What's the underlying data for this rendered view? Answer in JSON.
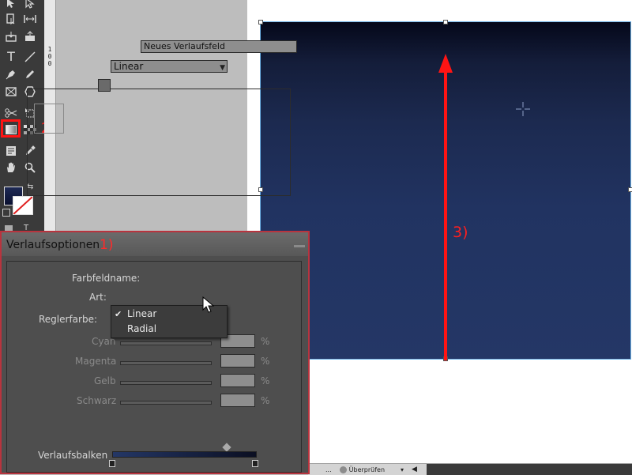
{
  "toolbar": {
    "highlight_color": "#ff1414",
    "tools": [
      {
        "id": "selection",
        "icon": "selection-arrow-icon"
      },
      {
        "id": "direct-selection",
        "icon": "direct-selection-arrow-icon"
      },
      {
        "id": "page",
        "icon": "page-tool-icon"
      },
      {
        "id": "gap",
        "icon": "gap-tool-icon"
      },
      {
        "id": "content-collector",
        "icon": "content-collector-icon"
      },
      {
        "id": "content-placer",
        "icon": "content-placer-icon"
      },
      {
        "id": "type",
        "icon": "type-tool-icon",
        "glyph": "T"
      },
      {
        "id": "line",
        "icon": "line-tool-icon"
      },
      {
        "id": "pen",
        "icon": "pen-tool-icon"
      },
      {
        "id": "pencil",
        "icon": "pencil-tool-icon"
      },
      {
        "id": "rectangle-frame",
        "icon": "rectangle-frame-icon"
      },
      {
        "id": "polygon",
        "icon": "polygon-tool-icon"
      },
      {
        "id": "scissors",
        "icon": "scissors-icon"
      },
      {
        "id": "free-transform",
        "icon": "free-transform-icon"
      },
      {
        "id": "gradient-swatch",
        "icon": "gradient-swatch-tool-icon"
      },
      {
        "id": "gradient-feather",
        "icon": "gradient-feather-tool-icon"
      },
      {
        "id": "note",
        "icon": "note-tool-icon"
      },
      {
        "id": "eyedropper",
        "icon": "eyedropper-icon"
      },
      {
        "id": "hand",
        "icon": "hand-tool-icon"
      },
      {
        "id": "zoom",
        "icon": "zoom-tool-icon"
      }
    ]
  },
  "annotations": {
    "one": "1)",
    "two": "2)",
    "three": "3)",
    "color": "#ff1f1f"
  },
  "ruler": {
    "label": "1\n0\n0"
  },
  "canvas": {
    "gradient_top": "#05081a",
    "gradient_bottom": "#243766",
    "selection_color": "#6fb4e8"
  },
  "dialog": {
    "title": "Verlaufsoptionen",
    "swatch_name_label": "Farbfeldname:",
    "swatch_name_value": "Neues Verlaufsfeld",
    "type_label": "Art:",
    "type_value": "Linear",
    "stop_color_label": "Reglerfarbe:",
    "channels": [
      {
        "label": "Cyan",
        "unit": "%"
      },
      {
        "label": "Magenta",
        "unit": "%"
      },
      {
        "label": "Gelb",
        "unit": "%"
      },
      {
        "label": "Schwarz",
        "unit": "%"
      }
    ],
    "ramp_label": "Verlaufsbalken",
    "type_options": [
      {
        "label": "Linear",
        "checked": true
      },
      {
        "label": "Radial",
        "checked": false
      }
    ]
  },
  "statusbar": {
    "dots": "...",
    "preflight_label": "Überprüfen",
    "caret": "▾",
    "scroll": "◀"
  }
}
